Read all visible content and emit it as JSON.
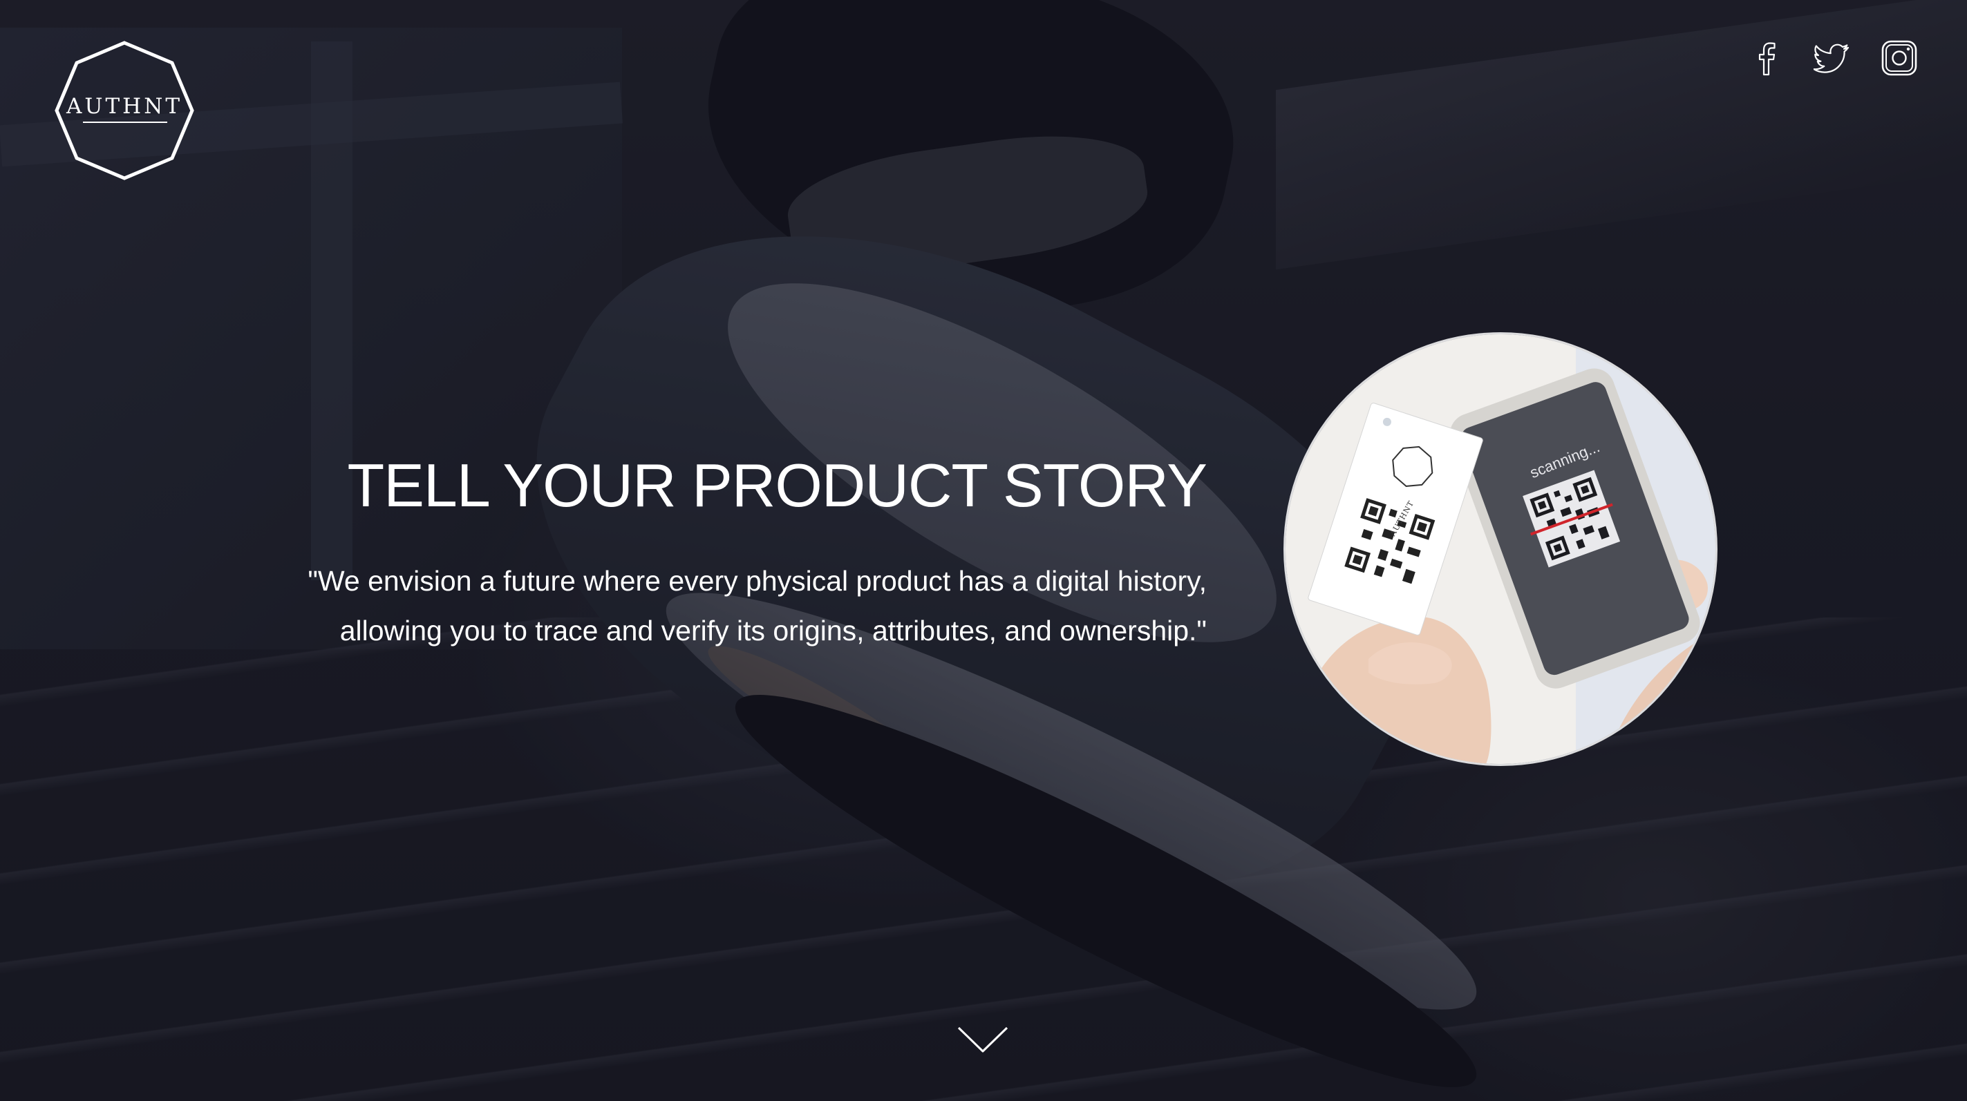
{
  "brand": {
    "logo_text": "AUTHNT"
  },
  "social": {
    "items": [
      {
        "name": "facebook",
        "icon": "facebook-icon"
      },
      {
        "name": "twitter",
        "icon": "twitter-icon"
      },
      {
        "name": "instagram",
        "icon": "instagram-icon"
      }
    ]
  },
  "hero": {
    "headline": "TELL YOUR PRODUCT STORY",
    "quote_line_1": "\"We envision a future where every physical product has a digital history,",
    "quote_line_2": "allowing you to trace and verify its origins, attributes, and ownership.\"",
    "image": {
      "phone_screen_text": "scanning...",
      "tag_logo_text": "AUTHNT"
    }
  },
  "scroll": {
    "icon": "chevron-down-icon"
  },
  "colors": {
    "background": "#1d1d27",
    "text": "#ffffff",
    "scan_line": "#d0242b"
  }
}
